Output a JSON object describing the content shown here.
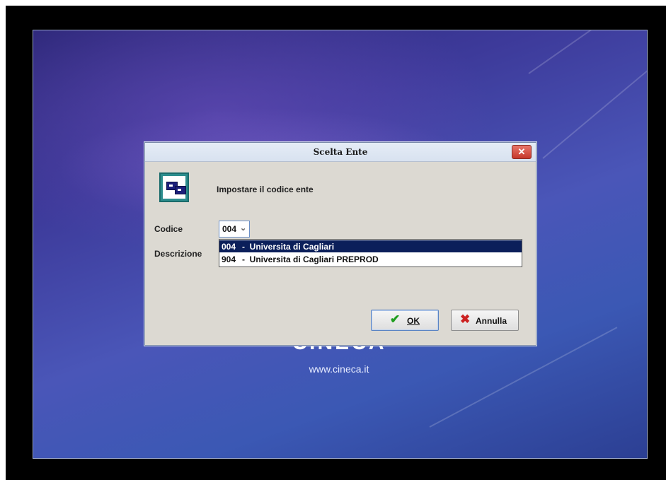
{
  "dialog": {
    "title": "Scelta Ente",
    "close_symbol": "✕",
    "heading": "Impostare il codice ente",
    "icon": "app-window-icon"
  },
  "form": {
    "codice_label": "Codice",
    "descrizione_label": "Descrizione",
    "selected_code": "004",
    "dropdown_chevron": "⌄"
  },
  "options": [
    {
      "code": "004",
      "desc": "-  Universita di Cagliari",
      "selected": true
    },
    {
      "code": "904",
      "desc": "-  Universita di Cagliari PREPROD",
      "selected": false
    }
  ],
  "buttons": {
    "ok_label": "OK",
    "ok_icon": "checkmark-icon",
    "cancel_label": "Annulla",
    "cancel_icon": "x-icon"
  },
  "splash": {
    "brand": "CINECA",
    "url": "www.cineca.it"
  },
  "colors": {
    "selection": "#0b1f5a",
    "ok_check": "#1f9e1f",
    "cancel_x": "#cc2222",
    "close_button": "#c6372a"
  }
}
